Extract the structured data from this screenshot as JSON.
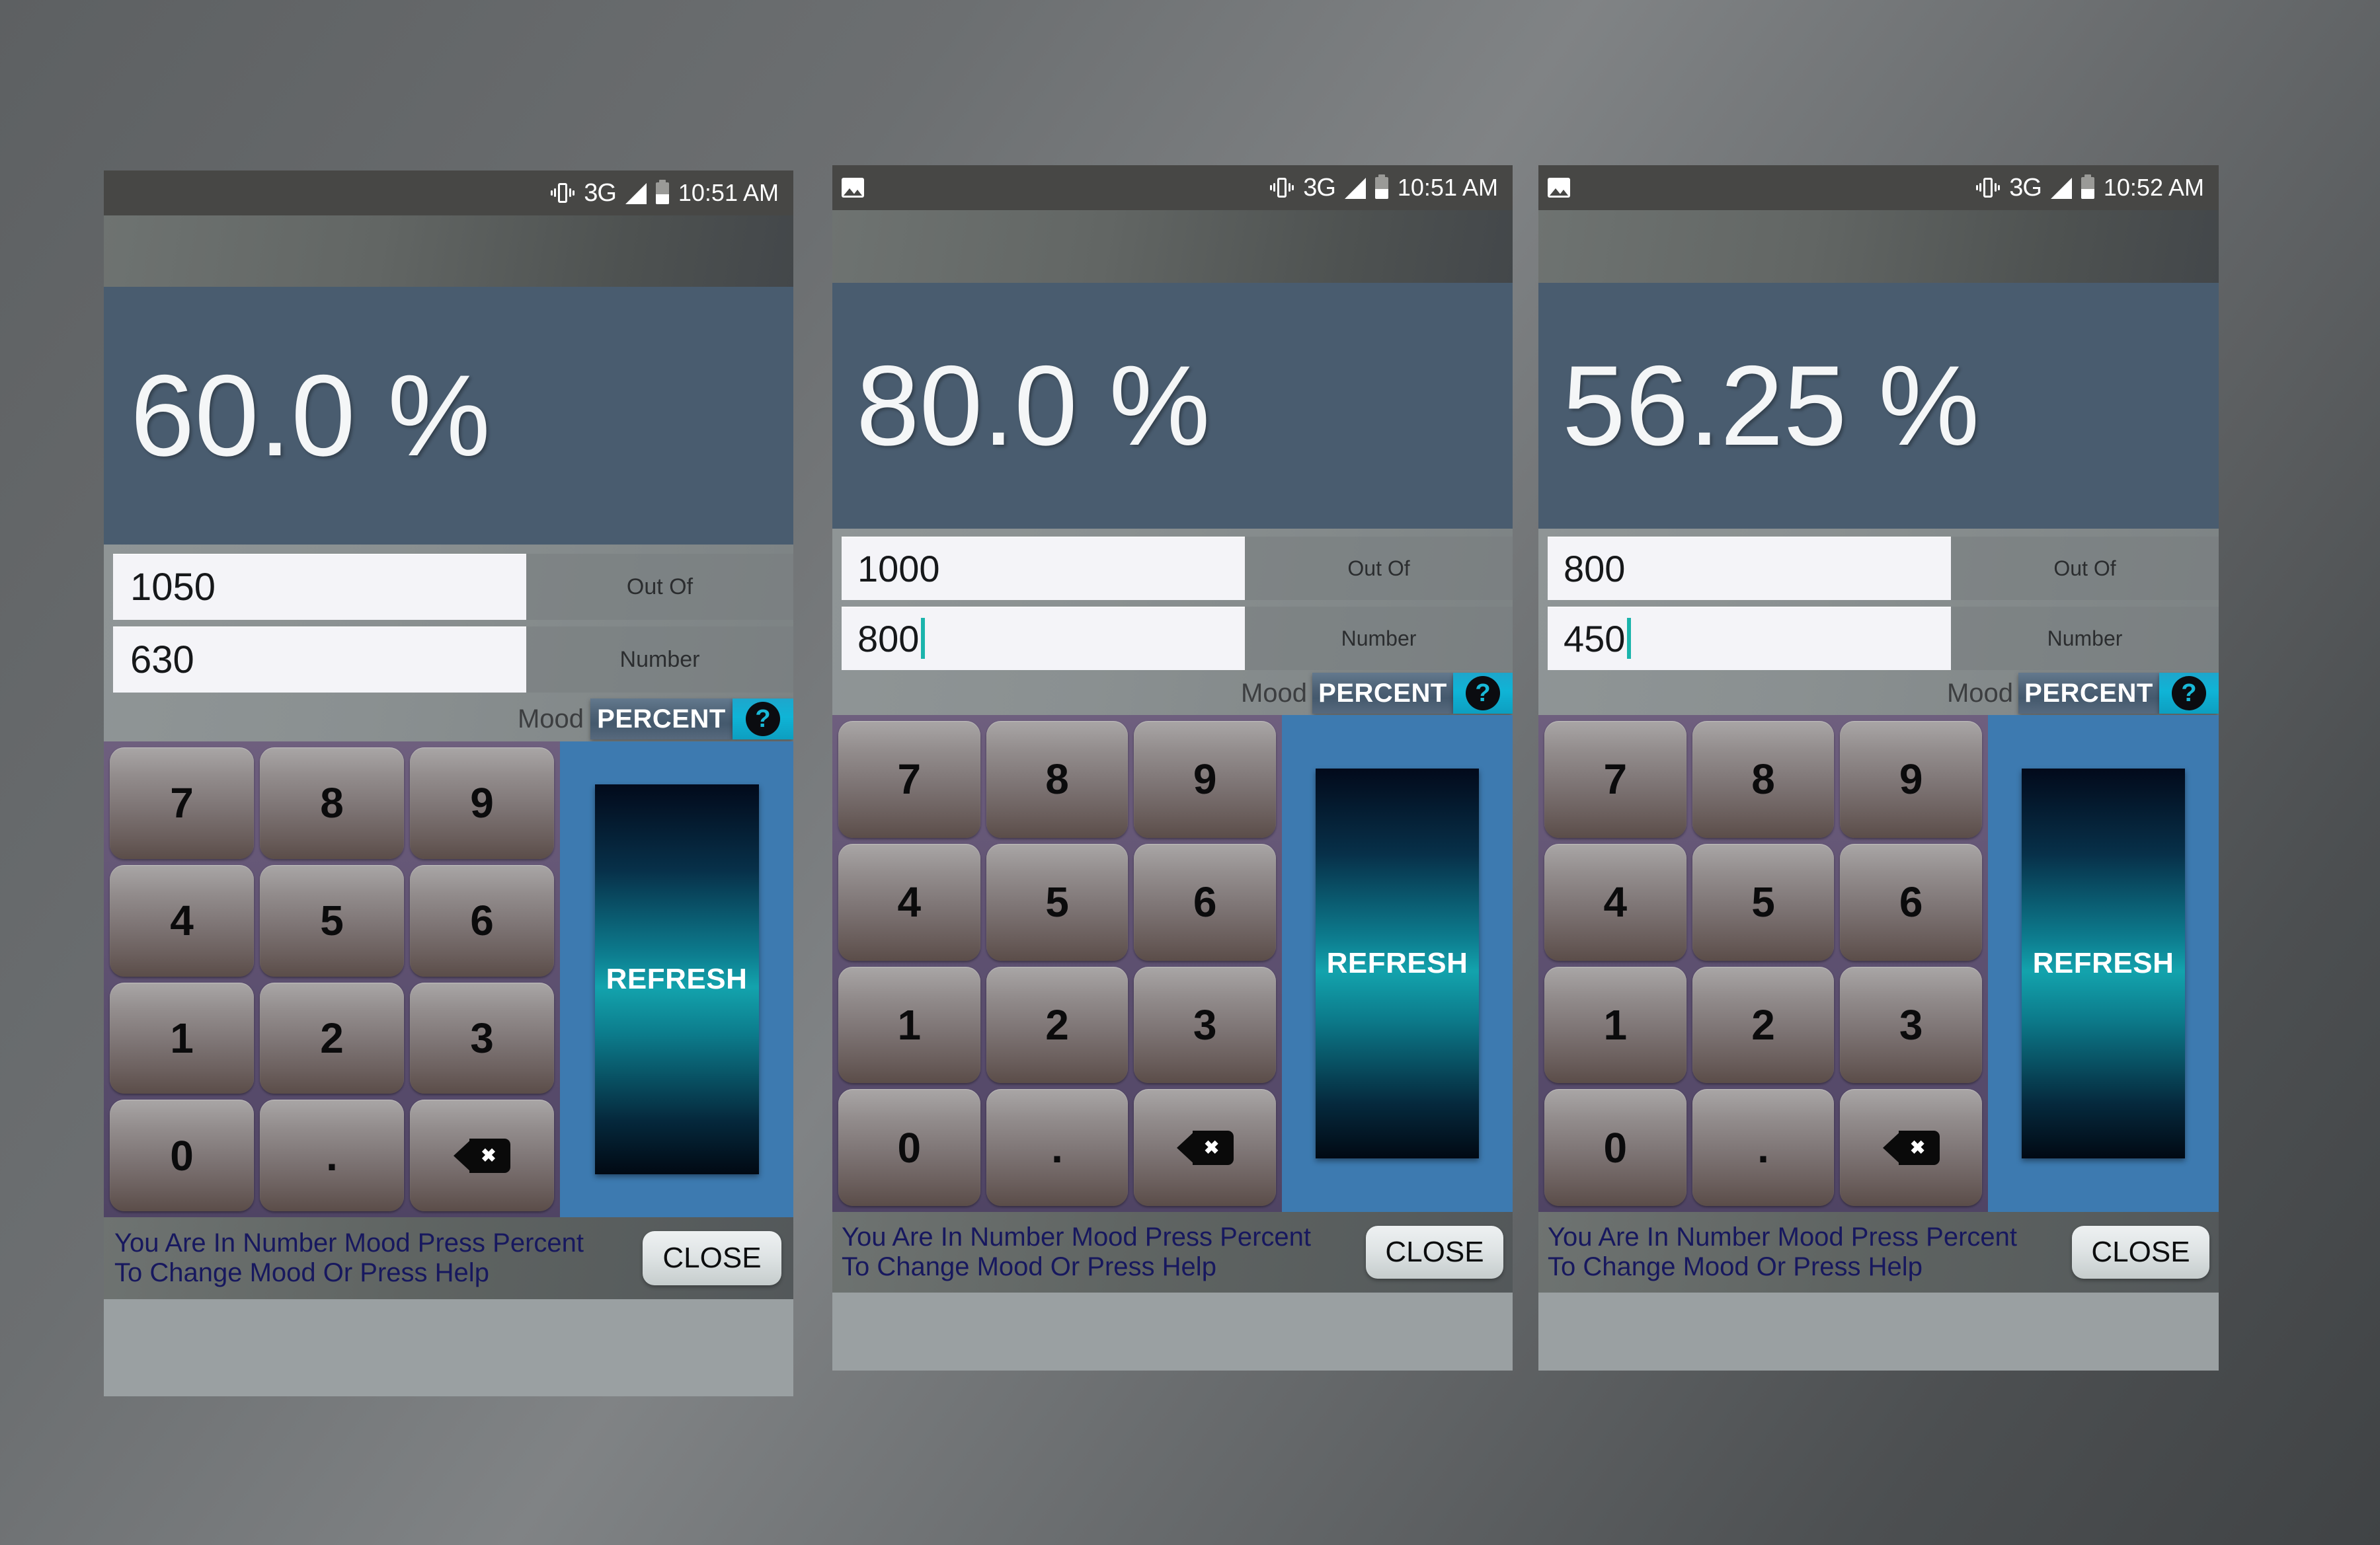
{
  "screen": {
    "background_color": "#6c6f71",
    "accent_teal": "#13a3ad",
    "banner_color": "#495c6f",
    "keypad_bg_color": "#5d5070",
    "panel_blue": "#3d7ab0"
  },
  "common": {
    "out_of_label": "Out Of",
    "number_label": "Number",
    "mood_label": "Mood",
    "percent_button_label": "PERCENT",
    "help_button_label": "?",
    "refresh_button_label": "REFRESH",
    "close_button_label": "CLOSE",
    "hint_text": "You Are In Number Mood Press Percent\nTo Change Mood Or Press Help",
    "network_label": "3G",
    "keys": [
      "7",
      "8",
      "9",
      "4",
      "5",
      "6",
      "1",
      "2",
      "3",
      "0",
      "."
    ],
    "backspace_key_label": "backspace",
    "icons": {
      "vibrate": "vibrate-icon",
      "signal": "signal-bars-icon",
      "battery": "battery-icon",
      "screenshot_notification": "image-notification-icon",
      "backspace": "backspace-icon",
      "help": "question-mark-icon"
    }
  },
  "panels": [
    {
      "id": "panel-1",
      "status_bar": {
        "has_image_notification": false,
        "network": "3G",
        "time": "10:51 AM",
        "battery_level_pct": 45
      },
      "percent_display": "60.0 %",
      "out_of_value": "1050",
      "number_value": "630",
      "number_field_focused": false,
      "mood": "PERCENT"
    },
    {
      "id": "panel-2",
      "status_bar": {
        "has_image_notification": true,
        "network": "3G",
        "time": "10:51 AM",
        "battery_level_pct": 45
      },
      "percent_display": "80.0 %",
      "out_of_value": "1000",
      "number_value": "800",
      "number_field_focused": true,
      "mood": "PERCENT"
    },
    {
      "id": "panel-3",
      "status_bar": {
        "has_image_notification": true,
        "network": "3G",
        "time": "10:52 AM",
        "battery_level_pct": 45
      },
      "percent_display": "56.25 %",
      "out_of_value": "800",
      "number_value": "450",
      "number_field_focused": true,
      "mood": "PERCENT"
    }
  ]
}
